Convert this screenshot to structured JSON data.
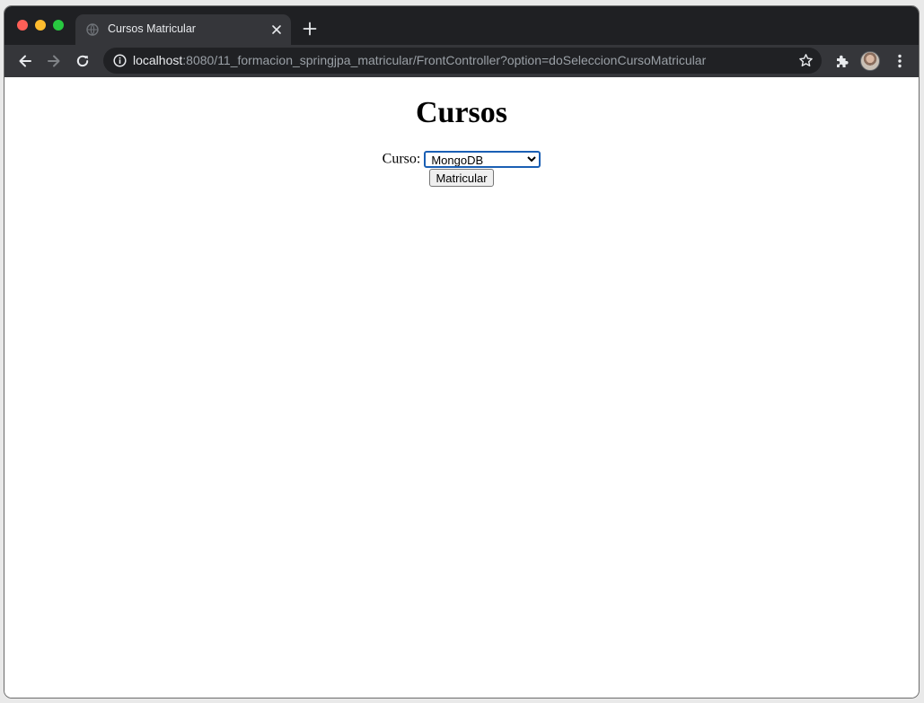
{
  "browser": {
    "tab_title": "Cursos Matricular",
    "url_host": "localhost",
    "url_rest": ":8080/11_formacion_springjpa_matricular/FrontController?option=doSeleccionCursoMatricular"
  },
  "page": {
    "heading": "Cursos",
    "curso_label": "Curso:",
    "curso_selected": "MongoDB",
    "submit_label": "Matricular"
  },
  "colors": {
    "tabstrip": "#1f2023",
    "toolbar": "#35363a",
    "omnibox": "#202124",
    "select_focus_border": "#1a5fb4"
  },
  "icons": {
    "back": "arrow-left-icon",
    "forward": "arrow-right-icon",
    "reload": "reload-icon",
    "info": "info-icon",
    "bookmark": "star-icon",
    "extensions": "puzzle-icon",
    "menu": "kebab-menu-icon"
  }
}
